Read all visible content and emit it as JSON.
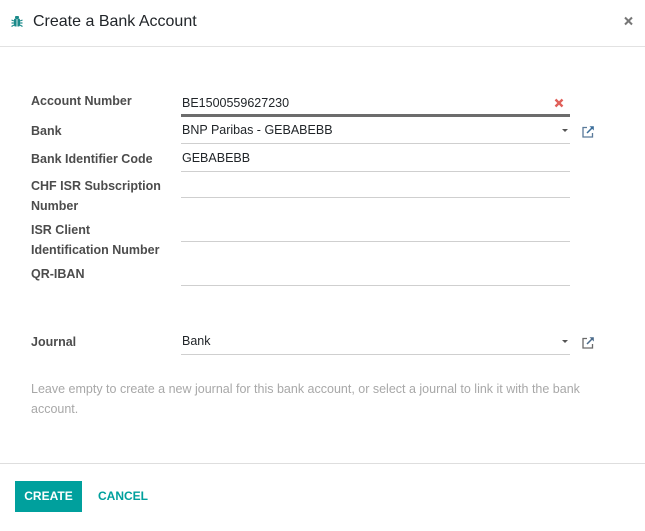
{
  "dialog": {
    "title": "Create a Bank Account",
    "title_icon": "bug-icon",
    "close_icon": "close-icon"
  },
  "form": {
    "account_number": {
      "label": "Account Number",
      "value": "BE1500559627230",
      "clear_icon": "clear-x-icon"
    },
    "bank": {
      "label": "Bank",
      "value": "BNP Paribas - GEBABEBB",
      "dropdown_icon": "caret-down-icon",
      "external_icon": "external-link-icon"
    },
    "bic": {
      "label": "Bank Identifier Code",
      "value": "GEBABEBB"
    },
    "chf_isr": {
      "label_line1": "CHF ISR Subscription",
      "label_line2": "Number",
      "value": ""
    },
    "isr_client": {
      "label_line1": "ISR Client",
      "label_line2": "Identification Number",
      "value": ""
    },
    "qr_iban": {
      "label": "QR-IBAN",
      "value": ""
    },
    "journal": {
      "label": "Journal",
      "value": "Bank",
      "dropdown_icon": "caret-down-icon",
      "external_icon": "external-link-icon"
    },
    "journal_help": "Leave empty to create a new journal for this bank account, or select a journal to link it with the bank account."
  },
  "footer": {
    "create_label": "CREATE",
    "cancel_label": "CANCEL"
  },
  "colors": {
    "accent": "#00a09d",
    "clear_icon": "#e0605a",
    "external_link_icon": "#3a6d9a",
    "help_text": "#a8a8a8"
  }
}
